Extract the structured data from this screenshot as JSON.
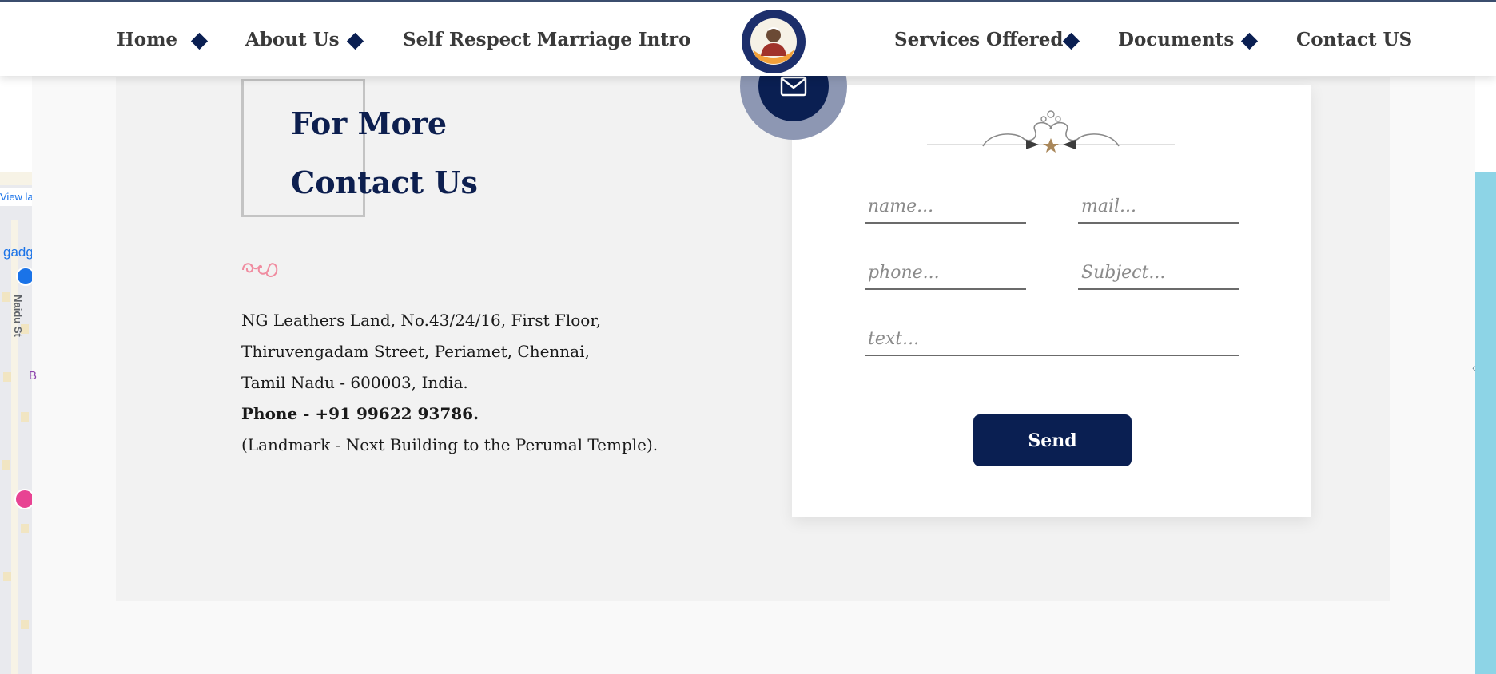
{
  "nav": {
    "left": [
      "Home",
      "About Us",
      "Self Respect Marriage Intro"
    ],
    "right": [
      "Services Offered",
      "Documents",
      "Contact US"
    ]
  },
  "map": {
    "link_text": "View larger map",
    "place_text": "gadget",
    "street_text": "Naidu St"
  },
  "contact": {
    "title_line1": "For More",
    "title_line2": "Contact Us",
    "address": {
      "line1": "NG Leathers Land, No.43/24/16, First Floor,",
      "line2": "Thiruvengadam Street, Periamet, Chennai,",
      "line3": "Tamil Nadu - 600003, India.",
      "phone": "Phone - +91 99622 93786.",
      "landmark": "(Landmark - Next Building to the Perumal Temple)."
    }
  },
  "form": {
    "name_placeholder": "name...",
    "mail_placeholder": "mail...",
    "phone_placeholder": "phone...",
    "subject_placeholder": "Subject...",
    "text_placeholder": "text...",
    "send_label": "Send"
  },
  "colors": {
    "navy": "#0a1f52",
    "section_bg": "#f2f2f2",
    "accent_pink": "#f08ca0"
  },
  "icons": [
    "mail-icon",
    "logo-emblem",
    "swirl-ornament",
    "divider-ornament"
  ]
}
